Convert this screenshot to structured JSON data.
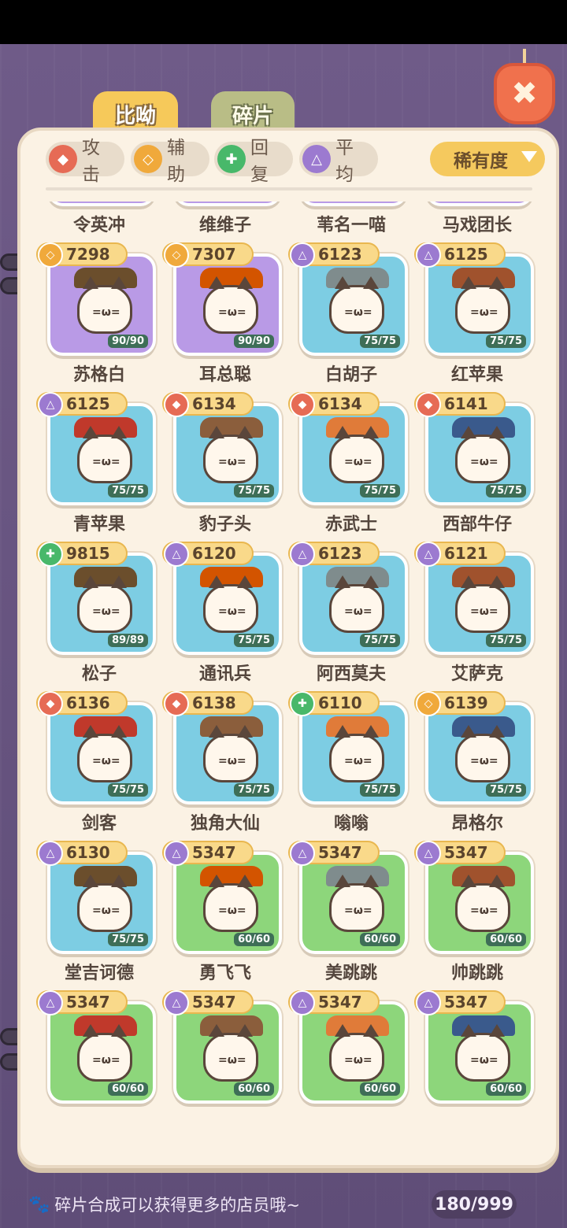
{
  "tabs": {
    "compare": "比呦",
    "fragments": "碎片"
  },
  "filters": {
    "attack": "攻击",
    "support": "辅助",
    "heal": "回复",
    "balance": "平均",
    "sort": "稀有度"
  },
  "colors": {
    "attack": "#e66b55",
    "support": "#f0a93b",
    "heal": "#48b86a",
    "balance": "#9c7ad0",
    "purple_bg": "#b99ae6",
    "blue_bg": "#7dcde3",
    "green_bg": "#8dd67b"
  },
  "cards": [
    {
      "name": "令英冲",
      "power": "",
      "role": "",
      "level": "90/90",
      "bg": "purple",
      "partial": true
    },
    {
      "name": "维维子",
      "power": "",
      "role": "",
      "level": "90/90",
      "bg": "purple",
      "partial": true
    },
    {
      "name": "苇名一喵",
      "power": "",
      "role": "",
      "level": "90/90",
      "bg": "purple",
      "partial": true
    },
    {
      "name": "马戏团长",
      "power": "",
      "role": "",
      "level": "90/90",
      "bg": "purple",
      "partial": true
    },
    {
      "name": "苏格白",
      "power": "7298",
      "role": "support",
      "level": "90/90",
      "bg": "purple"
    },
    {
      "name": "耳总聪",
      "power": "7307",
      "role": "support",
      "level": "90/90",
      "bg": "purple"
    },
    {
      "name": "白胡子",
      "power": "6123",
      "role": "balance",
      "level": "75/75",
      "bg": "blue"
    },
    {
      "name": "红苹果",
      "power": "6125",
      "role": "balance",
      "level": "75/75",
      "bg": "blue"
    },
    {
      "name": "青苹果",
      "power": "6125",
      "role": "balance",
      "level": "75/75",
      "bg": "blue"
    },
    {
      "name": "豹子头",
      "power": "6134",
      "role": "attack",
      "level": "75/75",
      "bg": "blue"
    },
    {
      "name": "赤武士",
      "power": "6134",
      "role": "attack",
      "level": "75/75",
      "bg": "blue"
    },
    {
      "name": "西部牛仔",
      "power": "6141",
      "role": "attack",
      "level": "75/75",
      "bg": "blue"
    },
    {
      "name": "松子",
      "power": "9815",
      "role": "heal",
      "level": "89/89",
      "bg": "blue"
    },
    {
      "name": "通讯兵",
      "power": "6120",
      "role": "balance",
      "level": "75/75",
      "bg": "blue"
    },
    {
      "name": "阿西莫夫",
      "power": "6123",
      "role": "balance",
      "level": "75/75",
      "bg": "blue"
    },
    {
      "name": "艾萨克",
      "power": "6121",
      "role": "balance",
      "level": "75/75",
      "bg": "blue"
    },
    {
      "name": "剑客",
      "power": "6136",
      "role": "attack",
      "level": "75/75",
      "bg": "blue"
    },
    {
      "name": "独角大仙",
      "power": "6138",
      "role": "attack",
      "level": "75/75",
      "bg": "blue"
    },
    {
      "name": "嗡嗡",
      "power": "6110",
      "role": "heal",
      "level": "75/75",
      "bg": "blue"
    },
    {
      "name": "昂格尔",
      "power": "6139",
      "role": "support",
      "level": "75/75",
      "bg": "blue"
    },
    {
      "name": "堂吉诃德",
      "power": "6130",
      "role": "balance",
      "level": "75/75",
      "bg": "blue"
    },
    {
      "name": "勇飞飞",
      "power": "5347",
      "role": "balance",
      "level": "60/60",
      "bg": "green"
    },
    {
      "name": "美跳跳",
      "power": "5347",
      "role": "balance",
      "level": "60/60",
      "bg": "green"
    },
    {
      "name": "帅跳跳",
      "power": "5347",
      "role": "balance",
      "level": "60/60",
      "bg": "green"
    },
    {
      "name": "",
      "power": "5347",
      "role": "balance",
      "level": "60/60",
      "bg": "green"
    },
    {
      "name": "",
      "power": "5347",
      "role": "balance",
      "level": "60/60",
      "bg": "green"
    },
    {
      "name": "",
      "power": "5347",
      "role": "balance",
      "level": "60/60",
      "bg": "green"
    },
    {
      "name": "",
      "power": "5347",
      "role": "balance",
      "level": "60/60",
      "bg": "green"
    }
  ],
  "footer": {
    "tip": "碎片合成可以获得更多的店员哦~",
    "count": "180/999"
  }
}
